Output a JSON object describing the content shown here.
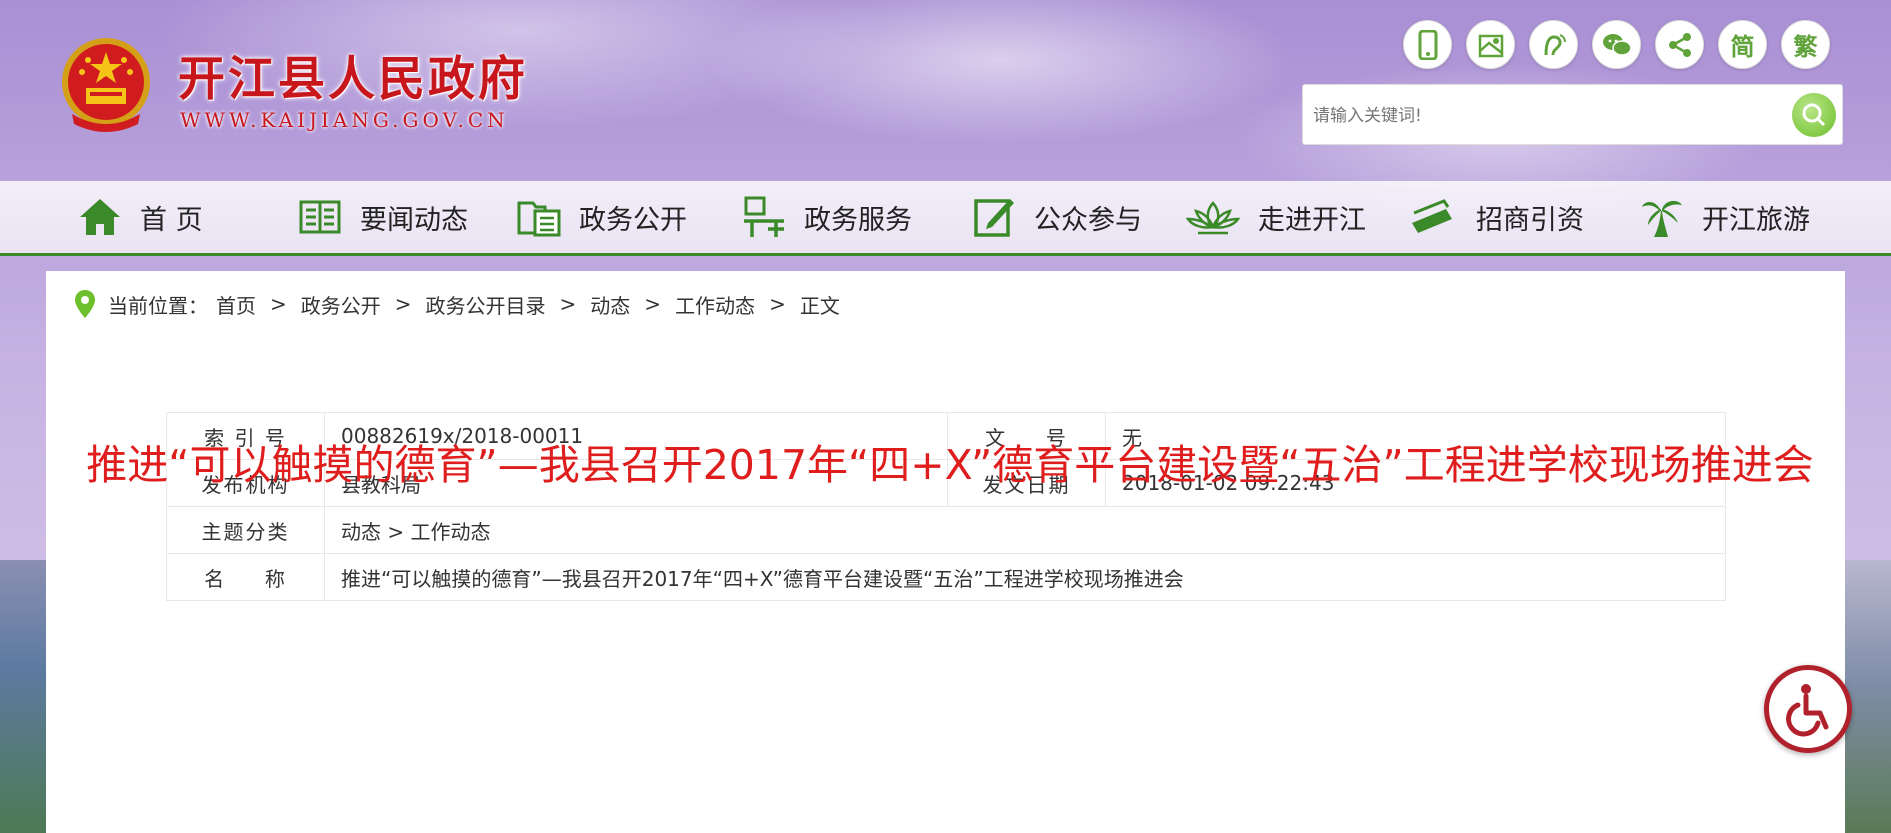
{
  "header": {
    "site_title": "开江县人民政府",
    "site_url": "WWW.KAIJIANG.GOV.CN",
    "tools": [
      {
        "icon": "mobile-icon",
        "label": ""
      },
      {
        "icon": "map-icon",
        "label": ""
      },
      {
        "icon": "voice-icon",
        "label": ""
      },
      {
        "icon": "wechat-icon",
        "label": ""
      },
      {
        "icon": "share-icon",
        "label": ""
      },
      {
        "icon": "simplified-icon",
        "label": "简"
      },
      {
        "icon": "traditional-icon",
        "label": "繁"
      }
    ],
    "search": {
      "placeholder": "请输入关键词!"
    }
  },
  "nav": {
    "items": [
      {
        "label": "首 页",
        "icon": "home-icon"
      },
      {
        "label": "要闻动态",
        "icon": "news-icon"
      },
      {
        "label": "政务公开",
        "icon": "folder-icon"
      },
      {
        "label": "政务服务",
        "icon": "service-icon"
      },
      {
        "label": "公众参与",
        "icon": "edit-icon"
      },
      {
        "label": "走进开江",
        "icon": "lotus-icon"
      },
      {
        "label": "招商引资",
        "icon": "investment-icon"
      },
      {
        "label": "开江旅游",
        "icon": "palm-icon"
      }
    ]
  },
  "breadcrumb": {
    "label": "当前位置：",
    "items": [
      "首页",
      "政务公开",
      "政务公开目录",
      "动态",
      "工作动态",
      "正文"
    ],
    "separator": ">"
  },
  "meta": {
    "index_label": "索 引 号",
    "index_value": "00882619x/2018-00011",
    "doc_no_label": "文 　 号",
    "doc_no_value": "无",
    "publisher_label": "发布机构",
    "publisher_value": "县教科局",
    "date_label": "发文日期",
    "date_value": "2018-01-02 09:22:43",
    "topic_label": "主题分类",
    "topic_value": "动态 > 工作动态",
    "name_label": "名 　 称",
    "name_value": "推进“可以触摸的德育”—我县召开2017年“四+X”德育平台建设暨“五治”工程进学校现场推进会"
  },
  "article": {
    "title": "推进“可以触摸的德育”—我县召开2017年“四+X”德育平台建设暨“五治”工程进学校现场推进会"
  },
  "colors": {
    "brand_red": "#c8161d",
    "title_red": "#e01d1d",
    "nav_green": "#3a8a2a",
    "icon_green": "#5fa33a"
  }
}
